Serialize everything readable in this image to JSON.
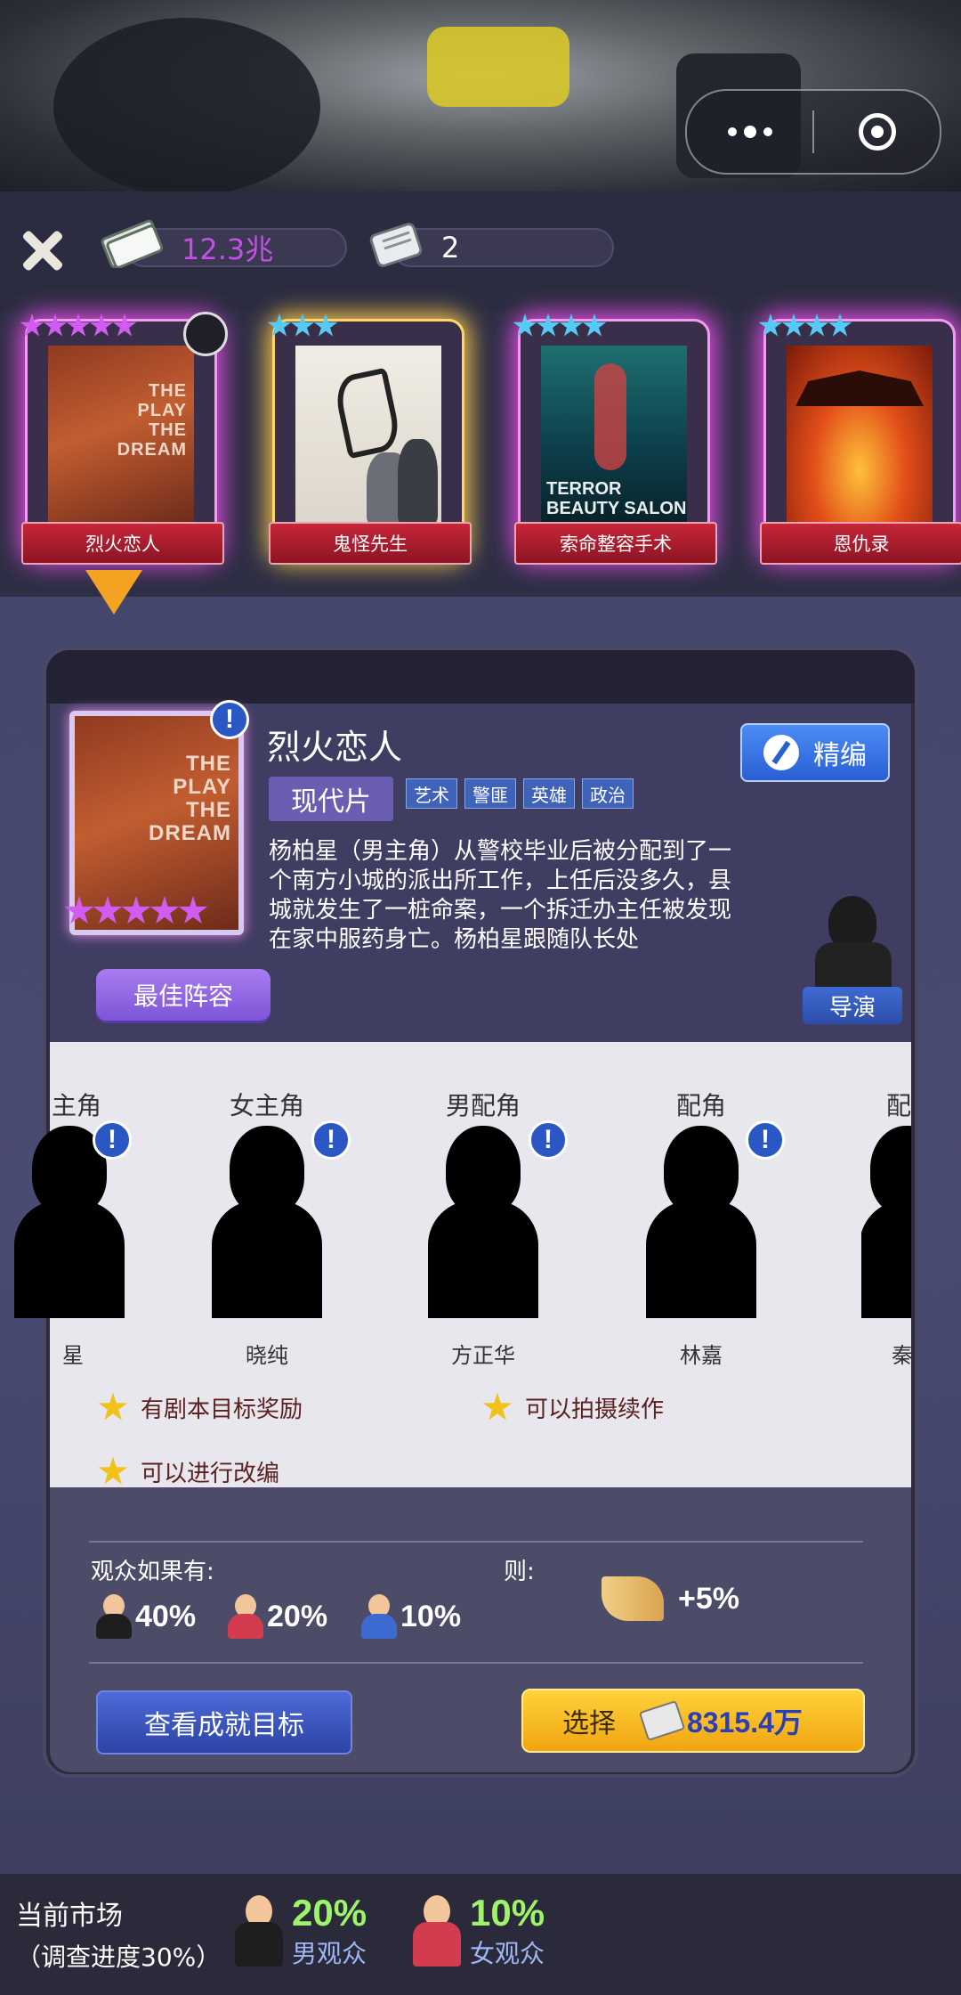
{
  "resources": {
    "money": "12.3兆",
    "tickets": "2"
  },
  "movies": [
    {
      "title": "烈火恋人",
      "stars": 5,
      "star_color": "pink",
      "poster_text": [
        "THE",
        "PLAY",
        "THE",
        "DREAM"
      ]
    },
    {
      "title": "鬼怪先生",
      "stars": 3,
      "star_color": "blue"
    },
    {
      "title": "索命整容手术",
      "stars": 4,
      "star_color": "blue",
      "poster_text": [
        "TERROR",
        "BEAUTY SALON"
      ]
    },
    {
      "title": "恩仇录",
      "stars": 4,
      "star_color": "blue"
    }
  ],
  "detail": {
    "title": "烈火恋人",
    "genre": "现代片",
    "tags": [
      "艺术",
      "警匪",
      "英雄",
      "政治"
    ],
    "edit_label": "精编",
    "synopsis": "杨柏星（男主角）从警校毕业后被分配到了一个南方小城的派出所工作，上任后没多久，县城就发生了一桩命案，一个拆迁办主任被发现在家中服药身亡。杨柏星跟随队长处",
    "best_cast_label": "最佳阵容",
    "director_label": "导演",
    "poster_text": [
      "THE",
      "PLAY",
      "THE",
      "DREAM"
    ]
  },
  "cast": [
    {
      "role": "主角",
      "name": "星"
    },
    {
      "role": "女主角",
      "name": "晓纯"
    },
    {
      "role": "男配角",
      "name": "方正华"
    },
    {
      "role": "配角",
      "name": "林嘉"
    },
    {
      "role": "配",
      "name": "秦"
    }
  ],
  "perks": [
    "有剧本目标奖励",
    "可以拍摄续作",
    "可以进行改编"
  ],
  "audience": {
    "if_label": "观众如果有:",
    "then_label": "则:",
    "items": [
      {
        "type": "male",
        "value": "40%"
      },
      {
        "type": "female",
        "value": "20%"
      },
      {
        "type": "child",
        "value": "10%"
      }
    ],
    "bonus": "+5%"
  },
  "buttons": {
    "goals": "查看成就目标",
    "select": "选择",
    "cost": "8315.4万"
  },
  "market": {
    "title": "当前市场",
    "progress": "（调查进度30%）",
    "male_pct": "20%",
    "male_label": "男观众",
    "female_pct": "10%",
    "female_label": "女观众"
  },
  "colors": {
    "accent_purple": "#c44fe6",
    "card_glow": "#e04be0",
    "select_gold": "#f0a512",
    "market_green": "#9ff26b"
  }
}
